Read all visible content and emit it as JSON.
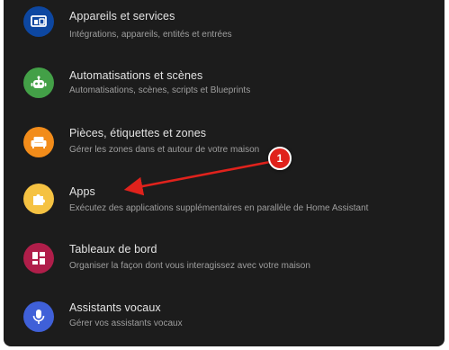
{
  "menu": {
    "items": [
      {
        "title": "Appareils et services",
        "subtitle": "Intégrations, appareils, entités et entrées",
        "icon": "devices-icon",
        "color": "#0d47a1"
      },
      {
        "title": "Automatisations et scènes",
        "subtitle": "Automatisations, scènes, scripts et Blueprints",
        "icon": "robot-icon",
        "color": "#43a047"
      },
      {
        "title": "Pièces, étiquettes et zones",
        "subtitle": "Gérer les zones dans et autour de votre maison",
        "icon": "sofa-icon",
        "color": "#f28c1a"
      },
      {
        "title": "Apps",
        "subtitle": "Exécutez des applications supplémentaires en parallèle de Home Assistant",
        "icon": "puzzle-icon",
        "color": "#f5c242"
      },
      {
        "title": "Tableaux de bord",
        "subtitle": "Organiser la façon dont vous interagissez avec votre maison",
        "icon": "dashboard-icon",
        "color": "#b01e4a"
      },
      {
        "title": "Assistants vocaux",
        "subtitle": "Gérer vos assistants vocaux",
        "icon": "microphone-icon",
        "color": "#3f60d8"
      }
    ]
  },
  "annotation": {
    "badge_label": "1",
    "color": "#e0221c"
  }
}
